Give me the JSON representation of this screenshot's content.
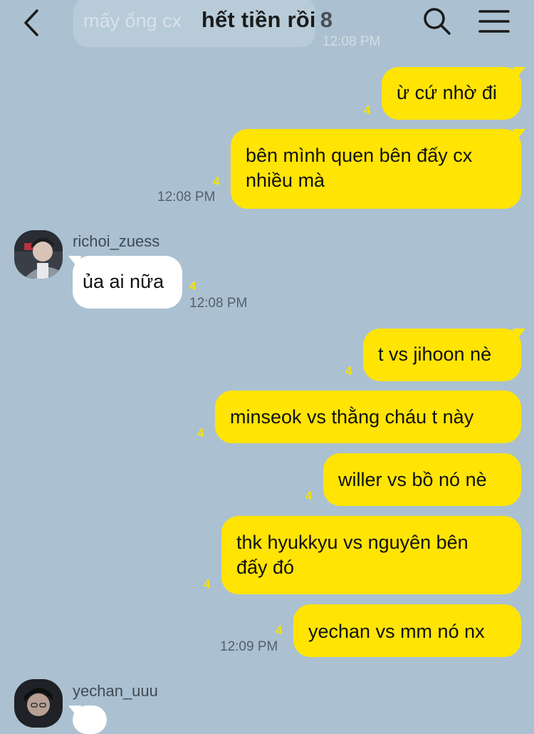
{
  "header": {
    "title": "hết tiền rồi",
    "member_count": "8",
    "ghost_message": "mấy ổng cx",
    "ghost_time": "12:08 PM"
  },
  "messages": [
    {
      "text": "ừ cứ nhờ đi",
      "unread": "4",
      "time": ""
    },
    {
      "text": "bên mình quen bên đấy cx nhiều mà",
      "line1": "bên mình quen bên đấy cx",
      "line2": "nhiều mà",
      "unread": "4",
      "time": "12:08 PM"
    },
    {
      "sender": "richoi_zuess",
      "text": "ủa ai nữa",
      "unread": "4",
      "time": "12:08 PM"
    },
    {
      "text": "t vs jihoon nè",
      "unread": "4",
      "time": ""
    },
    {
      "text": "minseok vs thằng cháu t này",
      "unread": "4",
      "time": ""
    },
    {
      "text": "willer vs bồ nó nè",
      "unread": "4",
      "time": ""
    },
    {
      "text": "thk hyukkyu vs nguyên bên đấy đó",
      "line1": "thk hyukkyu vs nguyên bên",
      "line2": "đấy đó",
      "unread": "4",
      "time": ""
    },
    {
      "text": "yechan vs mm nó nx",
      "unread": "4",
      "time": "12:09 PM"
    },
    {
      "sender": "yechan_uuu"
    }
  ],
  "colors": {
    "background": "#abc1d1",
    "my_bubble": "#ffe404",
    "other_bubble": "#ffffff",
    "unread": "#f4e300"
  },
  "icons": [
    "back-arrow-icon",
    "search-icon",
    "menu-icon"
  ]
}
